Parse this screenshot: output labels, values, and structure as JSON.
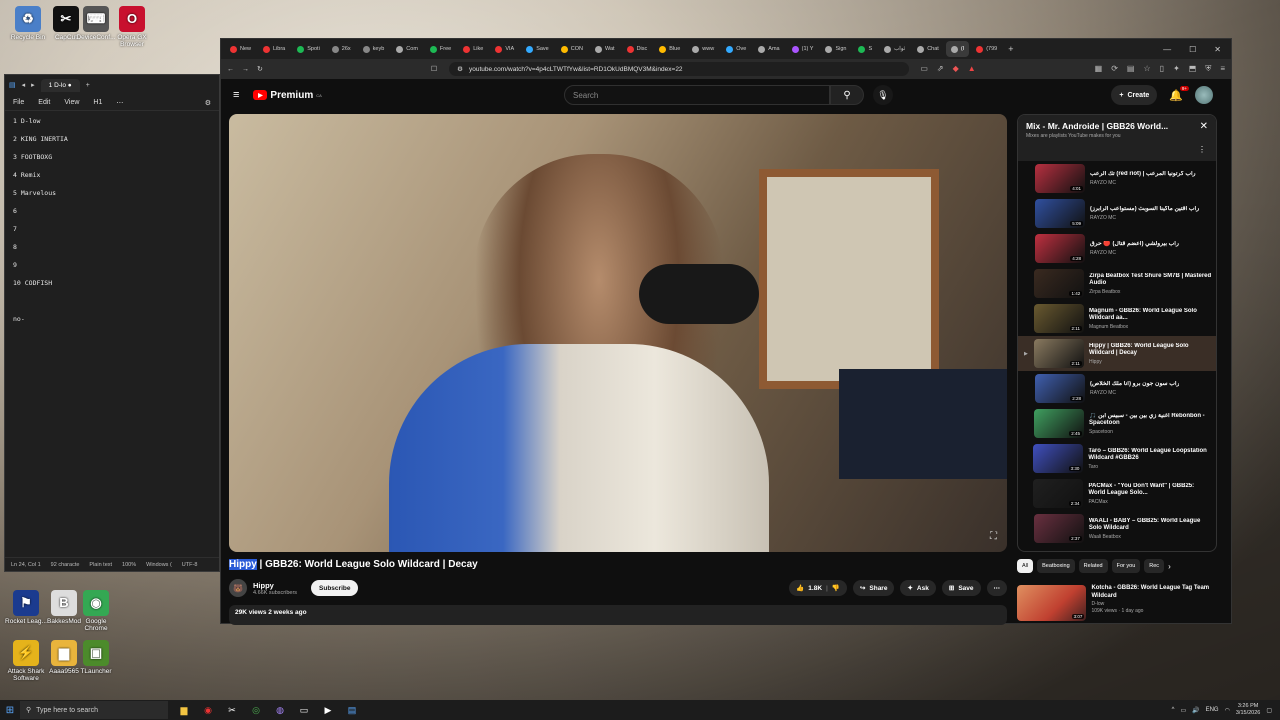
{
  "desktop": {
    "icons": [
      {
        "label": "Recycle Bin",
        "glyph": "♻",
        "color": "#4a7fc8"
      },
      {
        "label": "CapCut",
        "glyph": "✂",
        "color": "#111111"
      },
      {
        "label": "DeviceConf...",
        "glyph": "⌨",
        "color": "#555555"
      },
      {
        "label": "Opera GX Browser",
        "glyph": "O",
        "color": "#c8102e"
      },
      {
        "label": "Rocket Leag...",
        "glyph": "⚑",
        "color": "#1b3b8f"
      },
      {
        "label": "BakkesMod",
        "glyph": "B",
        "color": "#dddddd"
      },
      {
        "label": "Google Chrome",
        "glyph": "◉",
        "color": "#34a853"
      },
      {
        "label": "Attack Shark Software",
        "glyph": "⚡",
        "color": "#e5b31b"
      },
      {
        "label": "Aaaa9565",
        "glyph": "▆",
        "color": "#e9b43c"
      },
      {
        "label": "TLauncher",
        "glyph": "▣",
        "color": "#4c8b2b"
      }
    ]
  },
  "notepad": {
    "tab_title": "1 D-lo",
    "menu": [
      "File",
      "Edit",
      "View",
      "H1"
    ],
    "lines": [
      "1 D-low",
      "2 KING INERTIA",
      "3 FOOTBOXG",
      "4 Remix",
      "5 Marvelous",
      "6",
      "7",
      "8",
      "9",
      "10 CODFISH",
      "",
      "no-"
    ],
    "status": {
      "position": "Ln 24, Col 1",
      "chars": "92 characte",
      "format": "Plain text",
      "zoom": "100%",
      "eol": "Windows (",
      "encoding": "UTF-8"
    }
  },
  "browser": {
    "tabs": [
      {
        "label": "New",
        "color": "#e33"
      },
      {
        "label": "Libra",
        "color": "#e33"
      },
      {
        "label": "Spoti",
        "color": "#1db954"
      },
      {
        "label": "26x",
        "color": "#888"
      },
      {
        "label": "keyb",
        "color": "#888"
      },
      {
        "label": "Com",
        "color": "#aaa"
      },
      {
        "label": "Free",
        "color": "#1db954"
      },
      {
        "label": "Like",
        "color": "#e33"
      },
      {
        "label": "VIA",
        "color": "#e33"
      },
      {
        "label": "Save",
        "color": "#3af"
      },
      {
        "label": "CON",
        "color": "#fb0"
      },
      {
        "label": "Wat",
        "color": "#aaa"
      },
      {
        "label": "Disc",
        "color": "#e33"
      },
      {
        "label": "Blue",
        "color": "#fb0"
      },
      {
        "label": "www",
        "color": "#aaa"
      },
      {
        "label": "Ove",
        "color": "#3af"
      },
      {
        "label": "Ama",
        "color": "#aaa"
      },
      {
        "label": "(1) Y",
        "color": "#a5f"
      },
      {
        "label": "Sign",
        "color": "#aaa"
      },
      {
        "label": "S",
        "color": "#1db954"
      },
      {
        "label": "ثواب",
        "color": "#aaa"
      },
      {
        "label": "Chat",
        "color": "#aaa"
      },
      {
        "label": "(I",
        "color": "#aaa",
        "active": true
      },
      {
        "label": "(799",
        "color": "#e33"
      }
    ],
    "url": "youtube.com/watch?v=4p4cLTWTfYw&list=RD1OkUdBMQV3M&index=22",
    "window_controls": [
      "—",
      "☐",
      "✕"
    ]
  },
  "youtube": {
    "logo": "Premium",
    "logo_region": "CA",
    "search_placeholder": "Search",
    "create_label": "Create",
    "notif_count": "9+",
    "video_title_highlight": "Hippy",
    "video_title_rest": " | GBB26: World League Solo Wildcard | Decay",
    "channel": {
      "name": "Hippy",
      "subs": "4.66K subscribers",
      "subscribe": "Subscribe"
    },
    "actions": {
      "likes": "1.8K",
      "share": "Share",
      "ask": "Ask",
      "save": "Save"
    },
    "views": "29K views  2 weeks ago",
    "playlist": {
      "title": "Mix - Mr. Androide | GBB26 World...",
      "subtitle": "Mixes are playlists YouTube makes for you",
      "items": [
        {
          "title": "تك الرعب (red riot) | راب كرتونيا المرعب",
          "channel": "RAYZO MC",
          "duration": "4:01",
          "color": "#b83040"
        },
        {
          "title": "راب اقتين ماكينا السوبث (مستواعب الرابرز)",
          "channel": "RAYZO MC",
          "duration": "5:09",
          "color": "#3050a0"
        },
        {
          "title": "راب بيرولشي (اعضم قتال) 🔴 حرق",
          "channel": "RAYZO MC",
          "duration": "4:28",
          "color": "#c03040"
        },
        {
          "title": "Zirpa Beatbox Test Shure SM7B | Mastered Audio",
          "channel": "Zirpa Beatbox",
          "duration": "1:42",
          "color": "#3a2a20"
        },
        {
          "title": "Magnum - GBB26: World League Solo Wildcard aa...",
          "channel": "Magnum Beatbox",
          "duration": "2:11",
          "color": "#6a5a30"
        },
        {
          "title": "Hippy | GBB26: World League Solo Wildcard | Decay",
          "channel": "Hippy",
          "duration": "2:11",
          "color": "#8a7a60",
          "current": true
        },
        {
          "title": "راب سون جون برو (انا ملك الخلاص)",
          "channel": "RAYZO MC",
          "duration": "2:28",
          "color": "#4060b0"
        },
        {
          "title": "🎵 أغنية زي بين بين - سبيس ابن Rebonbon - Spacetoon",
          "channel": "Spacetoon",
          "duration": "2:45",
          "color": "#40a060"
        },
        {
          "title": "Taro – GBB26: World League Loopstation Wildcard #GBB26",
          "channel": "Taro",
          "duration": "3:30",
          "color": "#4050c0"
        },
        {
          "title": "PACMax - \"You Don't Want\" | GBB25: World League Solo...",
          "channel": "PACMax",
          "duration": "2:34",
          "color": "#202020"
        },
        {
          "title": "WAALI - BABY – GBB25: World League Solo Wildcard",
          "channel": "Waali Beatbox",
          "duration": "2:37",
          "color": "#6a3040"
        }
      ]
    },
    "chips": [
      "All",
      "Beatboxing",
      "Related",
      "For you",
      "Rec"
    ],
    "recommended": {
      "title": "Kotcha - GBB26: World League Tag Team Wildcard",
      "channel": "D-low",
      "meta": "109K views · 1 day ago",
      "duration": "3:07"
    }
  },
  "taskbar": {
    "search_placeholder": "Type here to search",
    "language": "ENG",
    "time": "3:26 PM",
    "date": "3/15/2026"
  }
}
